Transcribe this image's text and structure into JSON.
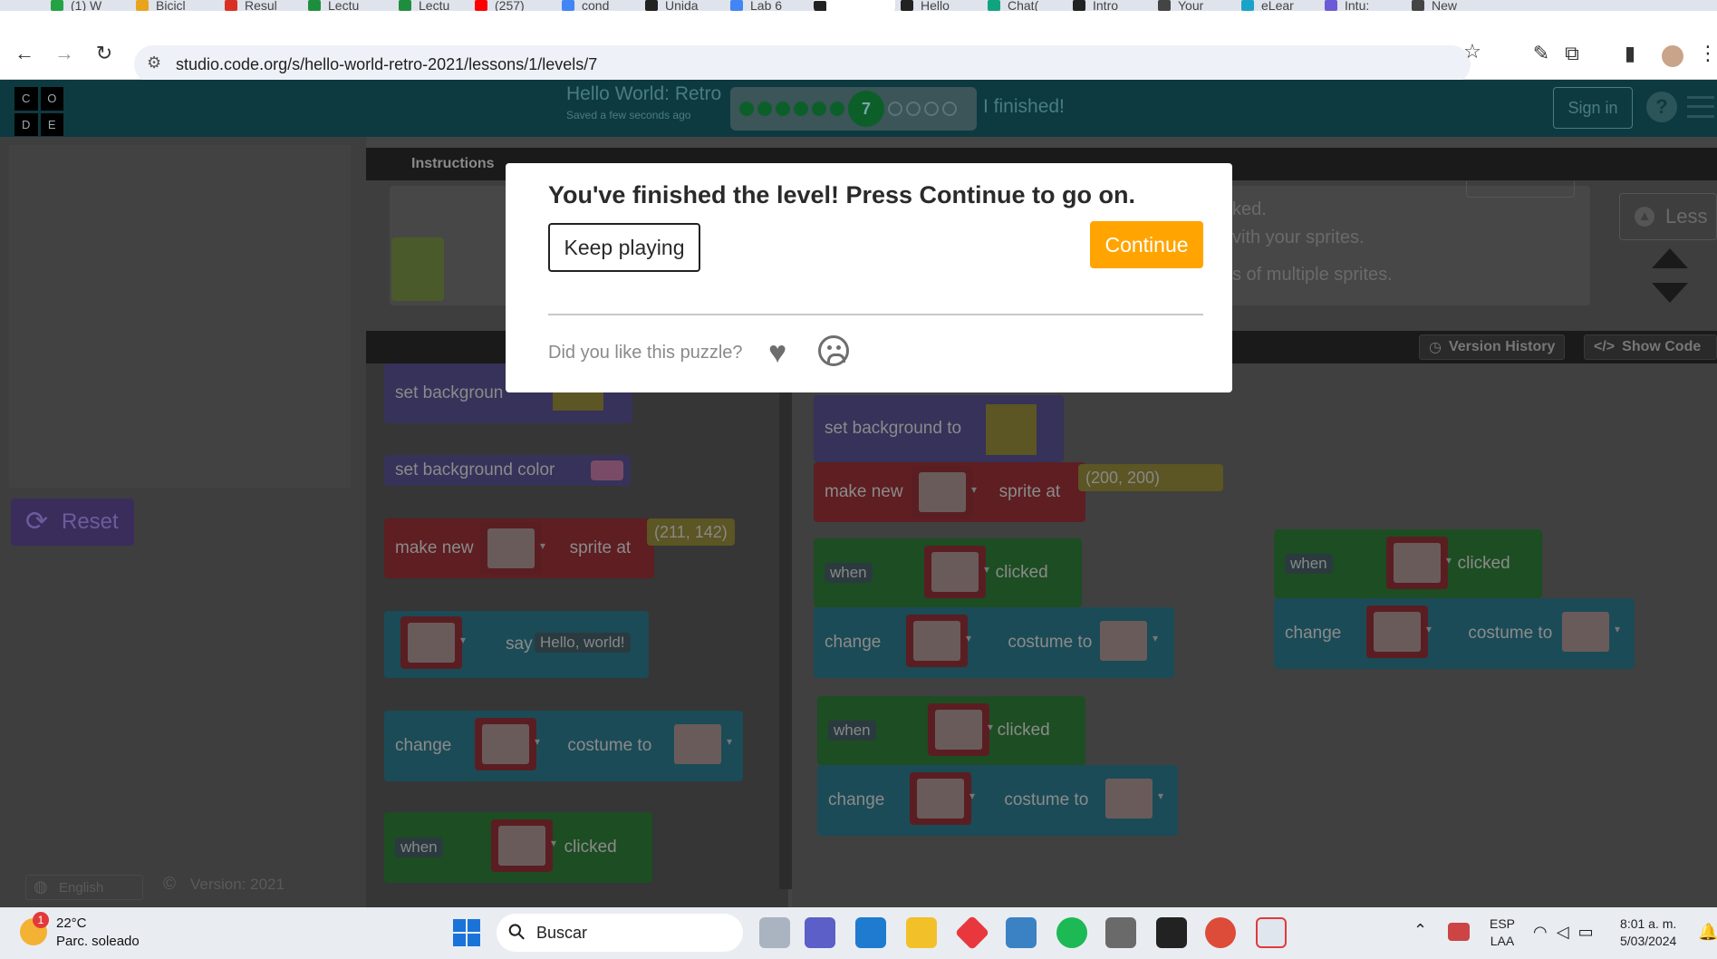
{
  "browser": {
    "tabs": [
      {
        "label": "(1) W",
        "color": "#25a244"
      },
      {
        "label": "Bicicl",
        "color": "#e8a41c"
      },
      {
        "label": "Resul",
        "color": "#d93025"
      },
      {
        "label": "Lectu",
        "color": "#1e8e3e"
      },
      {
        "label": "Lectu",
        "color": "#1e8e3e"
      },
      {
        "label": "(257)",
        "color": "#ff0000"
      },
      {
        "label": "cond",
        "color": "#4285f4"
      },
      {
        "label": "Unida",
        "color": "#222222"
      },
      {
        "label": "Lab 6",
        "color": "#4285f4"
      },
      {
        "label": "",
        "color": "#222222"
      },
      {
        "label": "Hello",
        "color": "#222222"
      },
      {
        "label": "Chat(",
        "color": "#10a37f"
      },
      {
        "label": "Intro",
        "color": "#222222"
      },
      {
        "label": "Your",
        "color": "#444444"
      },
      {
        "label": "eLear",
        "color": "#1aa3c9"
      },
      {
        "label": "Intu:",
        "color": "#6b5bd6"
      },
      {
        "label": "New",
        "color": "#444444"
      }
    ],
    "url": "studio.code.org/s/hello-world-retro-2021/lessons/1/levels/7"
  },
  "app": {
    "logo_letters": [
      "C",
      "O",
      "D",
      "E"
    ],
    "project_title": "Hello World: Retro",
    "saved_status": "Saved a few seconds ago",
    "current_level": "7",
    "finished_label": "I finished!",
    "sign_in": "Sign in",
    "help": "?"
  },
  "instructions": {
    "tab_label": "Instructions",
    "line1": "ked.",
    "line2": "vith your sprites.",
    "line3": "s of multiple sprites.",
    "less_label": "Less"
  },
  "workspace_toolbar": {
    "version_history": "Version History",
    "show_code": "Show Code"
  },
  "reset_label": "Reset",
  "footer": {
    "language": "English",
    "version": "Version: 2021"
  },
  "toolbox_blocks": {
    "set_bg": "set backgroun",
    "set_bg_color": "set background color",
    "make_new": "make new",
    "sprite_at": "sprite at",
    "coord": "(211, 142)",
    "say": "say",
    "say_text": "Hello, world!",
    "change": "change",
    "costume_to": "costume to",
    "when": "when",
    "clicked": "clicked"
  },
  "workspace_blocks": {
    "set_bg_to": "set background to",
    "make_new": "make new",
    "sprite_at": "sprite at",
    "coord": "(200, 200)",
    "when": "when",
    "clicked": "clicked",
    "change": "change",
    "costume_to": "costume to"
  },
  "modal": {
    "title": "You've finished the level! Press Continue to go on.",
    "keep_playing": "Keep playing",
    "continue": "Continue",
    "feedback_question": "Did you like this puzzle?"
  },
  "taskbar": {
    "notif_count": "1",
    "temperature": "22°C",
    "weather": "Parc. soleado",
    "search_placeholder": "Buscar",
    "lang_line1": "ESP",
    "lang_line2": "LAA",
    "time": "8:01 a. m.",
    "date": "5/03/2024"
  }
}
